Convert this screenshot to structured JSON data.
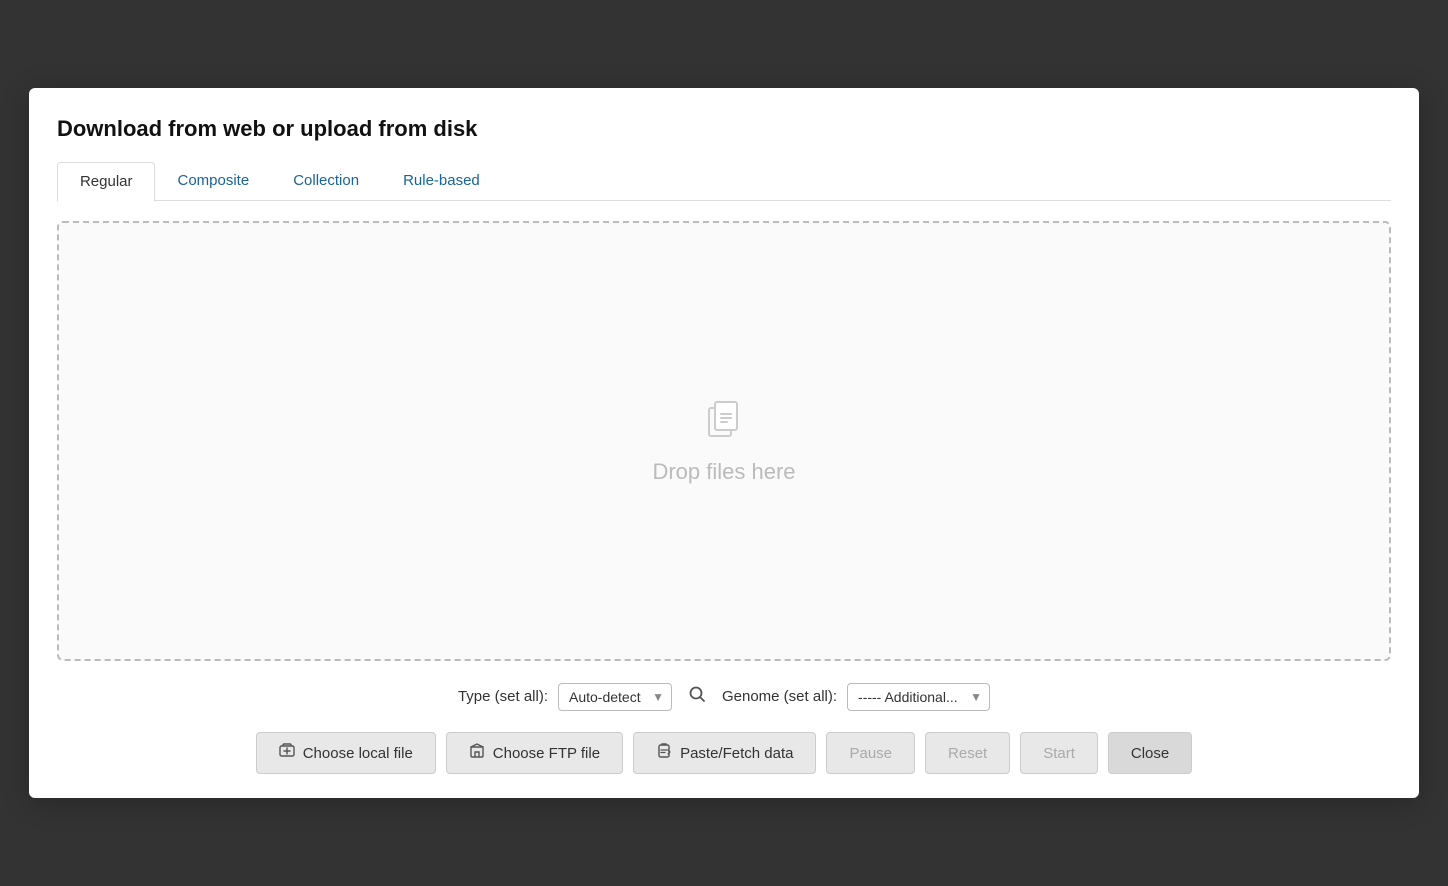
{
  "modal": {
    "title": "Download from web or upload from disk",
    "tabs": [
      {
        "label": "Regular",
        "active": true
      },
      {
        "label": "Composite",
        "active": false
      },
      {
        "label": "Collection",
        "active": false
      },
      {
        "label": "Rule-based",
        "active": false
      }
    ],
    "drop_zone": {
      "text": "Drop files here",
      "icon": "📋"
    },
    "type_label": "Type (set all):",
    "type_value": "Auto-detect",
    "genome_label": "Genome (set all):",
    "genome_value": "----- Additional...",
    "buttons": [
      {
        "label": "Choose local file",
        "icon": "🖥",
        "name": "choose-local-file-button",
        "disabled": false
      },
      {
        "label": "Choose FTP file",
        "icon": "📂",
        "name": "choose-ftp-file-button",
        "disabled": false
      },
      {
        "label": "Paste/Fetch data",
        "icon": "✎",
        "name": "paste-fetch-button",
        "disabled": false
      },
      {
        "label": "Pause",
        "icon": "",
        "name": "pause-button",
        "disabled": true
      },
      {
        "label": "Reset",
        "icon": "",
        "name": "reset-button",
        "disabled": true
      },
      {
        "label": "Start",
        "icon": "",
        "name": "start-button",
        "disabled": true
      },
      {
        "label": "Close",
        "icon": "",
        "name": "close-button",
        "disabled": false
      }
    ]
  }
}
